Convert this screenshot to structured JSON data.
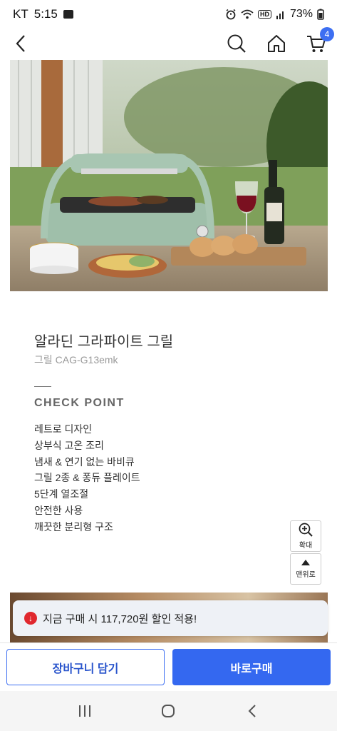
{
  "status_bar": {
    "carrier": "KT",
    "time": "5:15",
    "battery": "73%",
    "icons": [
      "gallery-icon",
      "alarm-icon",
      "wifi-icon",
      "hd-icon",
      "signal-icon"
    ],
    "hd_label": "HD"
  },
  "top_nav": {
    "back_icon": "chevron-left-icon",
    "search_icon": "search-icon",
    "home_icon": "home-icon",
    "cart_icon": "cart-icon",
    "cart_count": "4"
  },
  "product": {
    "title": "알라딘 그라파이트 그릴",
    "model": "그릴 CAG-G13emk",
    "image": "product-photo-grill"
  },
  "check_point": {
    "title": "CHECK POINT",
    "items": [
      "레트로 디자인",
      "상부식 고온 조리",
      "냄새 & 연기 없는 바비큐",
      "그릴 2종 & 퐁듀 플레이트",
      "5단계 열조절",
      "안전한 사용",
      "깨끗한 분리형 구조"
    ]
  },
  "float_tools": {
    "zoom_label": "확대",
    "top_label": "맨위로"
  },
  "discount_toast": {
    "text": "지금 구매 시 117,720원 할인 적용!",
    "icon": "down-arrow-circle-icon"
  },
  "action_bar": {
    "cart_label": "장바구니 담기",
    "buy_label": "바로구매"
  },
  "colors": {
    "accent": "#3468f0",
    "toast_icon": "#e0282e"
  }
}
